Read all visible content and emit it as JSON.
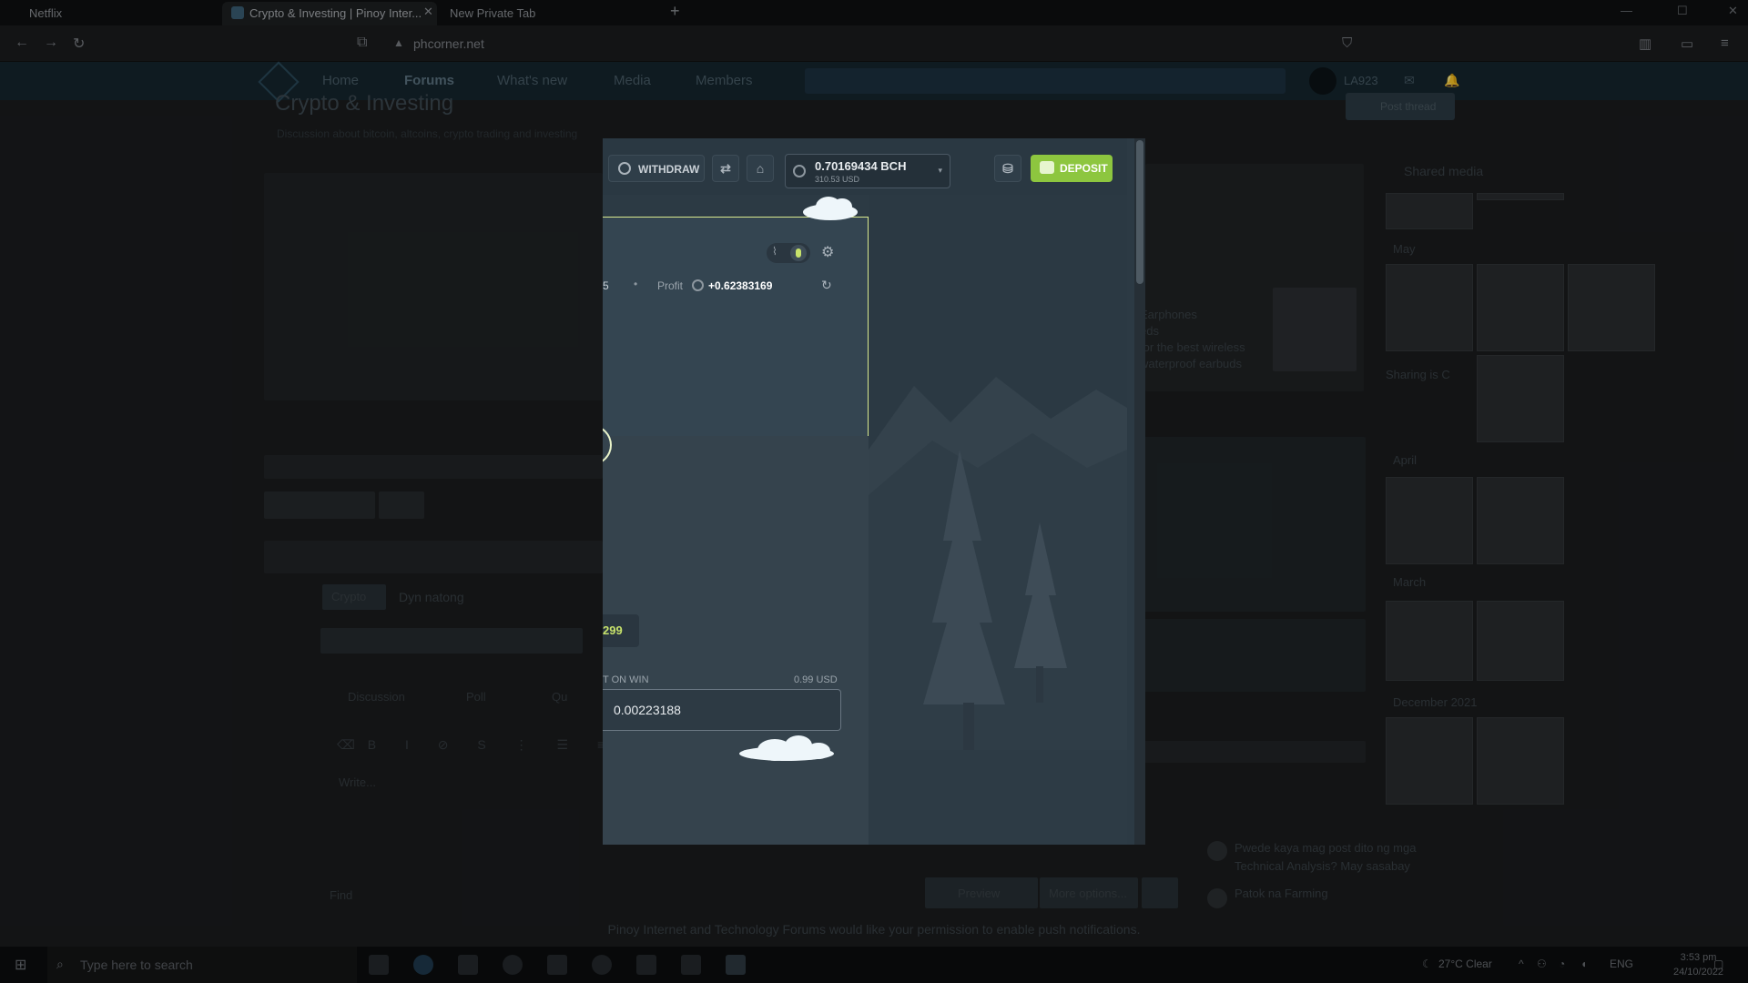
{
  "browser": {
    "tabs": [
      {
        "label": "Netflix"
      },
      {
        "label": "Crypto & Investing | Pinoy Inter..."
      },
      {
        "label": "New Private Tab"
      }
    ],
    "url": "phcorner.net"
  },
  "forum": {
    "nav": [
      "Home",
      "Forums",
      "What's new",
      "Media",
      "Members"
    ],
    "username": "LA923",
    "page_title": "Crypto & Investing",
    "page_desc": "Discussion about bitcoin, altcoins, crypto trading and investing",
    "post_thread": "Post thread",
    "editor": {
      "prefix": "Crypto",
      "title_placeholder": "Dyn natong",
      "tabs": [
        "Discussion",
        "Poll",
        "Qu"
      ],
      "body_placeholder": "Write...",
      "find": "Find",
      "preview": "Preview",
      "more_options": "More options..."
    },
    "sidebar": {
      "shared_media": "Shared media",
      "sections": [
        "May",
        "April",
        "March",
        "December 2021"
      ],
      "sharing_label": "Sharing is C",
      "snippets": [
        "Earphones",
        "eds",
        "for the best wireless",
        "waterproof earbuds"
      ],
      "bottom_items": [
        "Pwede kaya mag post dito ng mga Technical Analysis? May sasabay",
        "Patok na Farming"
      ]
    },
    "push_banner": "Pinoy Internet and Technology Forums would like your permission to enable push notifications."
  },
  "taskbar": {
    "search_placeholder": "Type here to search",
    "weather": "27°C  Clear",
    "lang": "ENG",
    "time": "3:53 pm",
    "date": "24/10/2022"
  },
  "casino": {
    "withdraw_label": "WITHDRAW",
    "balance": "0.70169434 BCH",
    "balance_usd": "310.53 USD",
    "deposit_label": "DEPOSIT",
    "stats_partial": "5",
    "profit_label": "Profit",
    "profit_value": "+0.62383169",
    "partial_value": "299",
    "win_label": "T ON WIN",
    "win_usd": "0.99 USD",
    "win_input": "0.00223188"
  },
  "colors": {
    "accent": "#8dc63f",
    "panel": "#344551",
    "frame": "#d9e98f"
  }
}
